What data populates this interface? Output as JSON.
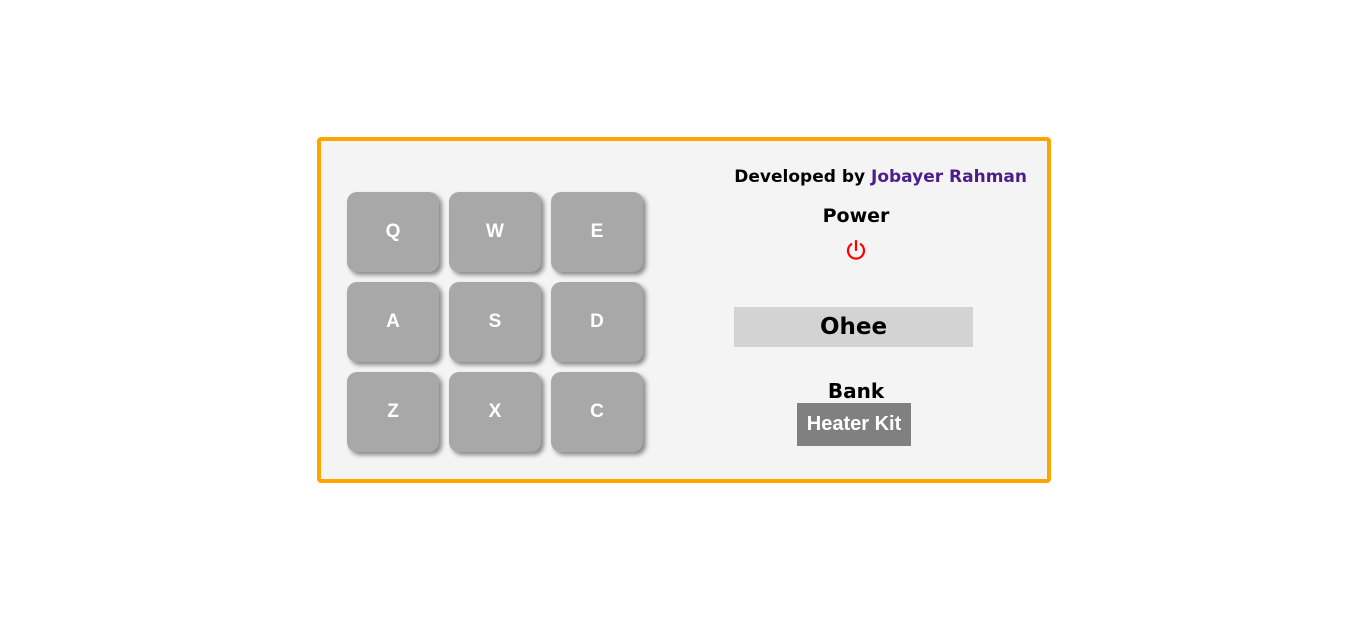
{
  "pads": [
    {
      "key": "Q"
    },
    {
      "key": "W"
    },
    {
      "key": "E"
    },
    {
      "key": "A"
    },
    {
      "key": "S"
    },
    {
      "key": "D"
    },
    {
      "key": "Z"
    },
    {
      "key": "X"
    },
    {
      "key": "C"
    }
  ],
  "credit": {
    "prefix": "Developed by",
    "author": "Jobayer Rahman"
  },
  "power": {
    "label": "Power",
    "icon": "power-icon",
    "icon_color": "#ff0000"
  },
  "display": {
    "text": "Ohee"
  },
  "bank": {
    "label": "Bank",
    "button_label": "Heater Kit"
  },
  "colors": {
    "border": "#ffa500",
    "pad": "#a8a8a8",
    "author": "#4b1e8a",
    "bank_button": "#808080"
  }
}
